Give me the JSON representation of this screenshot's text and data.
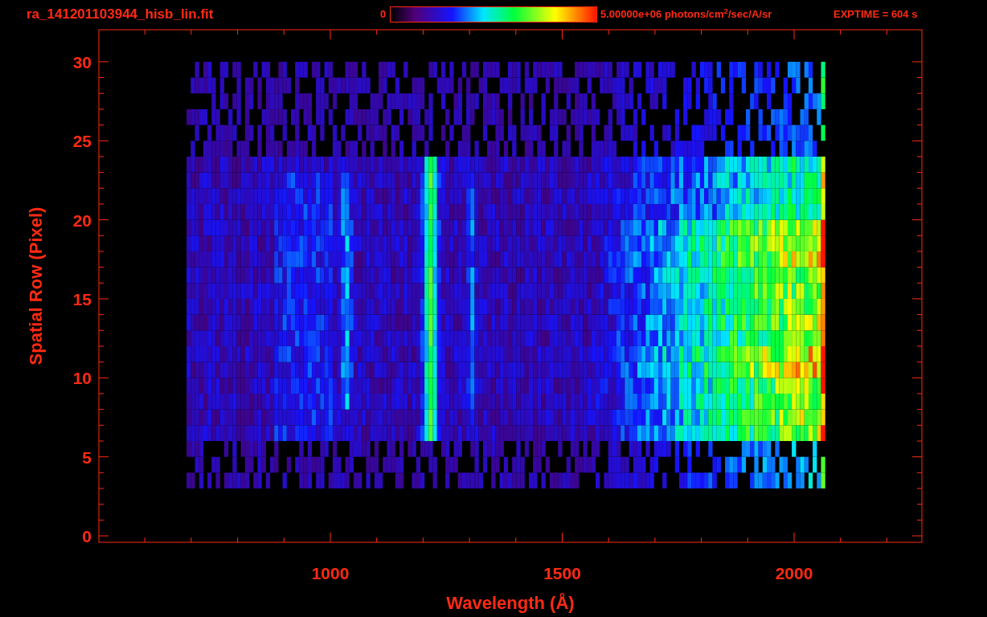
{
  "title": "ra_141201103944_hisb_lin.fit",
  "colorbar": {
    "min_label": "0",
    "max_label": "5.00000e+06 photons/cm$^{2}$/sec/A/sr"
  },
  "exposure": "EXPTIME = 604 s",
  "plot": {
    "x_axis": {
      "label": "Wavelength (Å)",
      "ticks": [
        "1000",
        "1500",
        "2000"
      ]
    },
    "y_axis": {
      "label": "Spatial Row (Pixel)",
      "ticks": [
        "30",
        "25",
        "20",
        "15",
        "10",
        "5",
        "0"
      ]
    }
  }
}
